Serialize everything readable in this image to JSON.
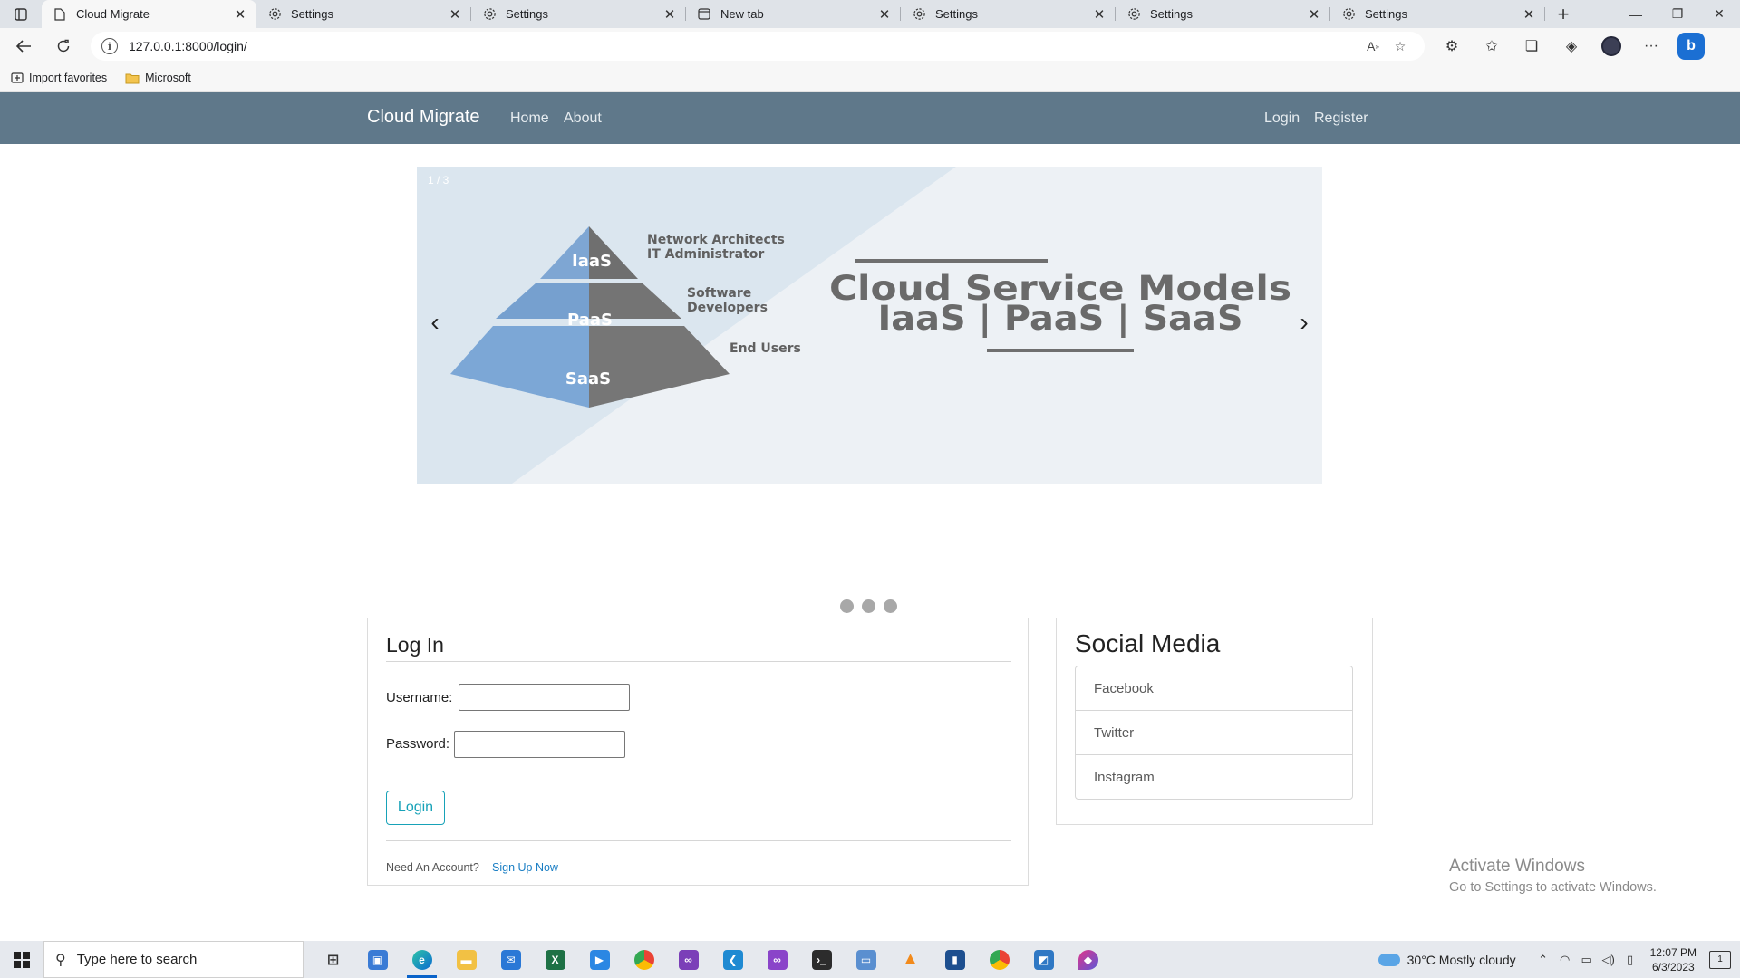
{
  "browser": {
    "tabs": [
      {
        "title": "Cloud Migrate",
        "icon": "page-icon",
        "active": true
      },
      {
        "title": "Settings",
        "icon": "gear-icon"
      },
      {
        "title": "Settings",
        "icon": "gear-icon"
      },
      {
        "title": "New tab",
        "icon": "newtab-icon"
      },
      {
        "title": "Settings",
        "icon": "gear-icon"
      },
      {
        "title": "Settings",
        "icon": "gear-icon"
      },
      {
        "title": "Settings",
        "icon": "gear-icon"
      }
    ],
    "url": "127.0.0.1:8000/login/",
    "bookmarks": [
      "Import favorites",
      "Microsoft"
    ]
  },
  "navbar": {
    "brand": "Cloud Migrate",
    "links": [
      "Home",
      "About"
    ],
    "right_links": [
      "Login",
      "Register"
    ],
    "color": "#5f788a"
  },
  "carousel": {
    "counter": "1 / 3",
    "slide": {
      "pyramid_labels": [
        "IaaS",
        "PaaS",
        "SaaS"
      ],
      "audience_1a": "Network Architects",
      "audience_1b": "IT Administrator",
      "audience_2a": "Software",
      "audience_2b": "Developers",
      "audience_3": "End Users",
      "headline_1": "Cloud Service Models",
      "headline_2": "IaaS | PaaS | SaaS"
    },
    "slide_count": 3
  },
  "login": {
    "title": "Log In",
    "username_label": "Username:",
    "username_value": "",
    "password_label": "Password:",
    "password_value": "",
    "submit_label": "Login",
    "account_prompt": "Need An Account?",
    "signup_link": "Sign Up Now",
    "accent": "#17a2b8"
  },
  "social": {
    "title": "Social Media",
    "items": [
      "Facebook",
      "Twitter",
      "Instagram"
    ]
  },
  "watermark": {
    "line1": "Activate Windows",
    "line2": "Go to Settings to activate Windows."
  },
  "taskbar": {
    "search_placeholder": "Type here to search",
    "weather": "30°C  Mostly cloudy",
    "time": "12:07 PM",
    "date": "6/3/2023",
    "notification_count": "1"
  }
}
